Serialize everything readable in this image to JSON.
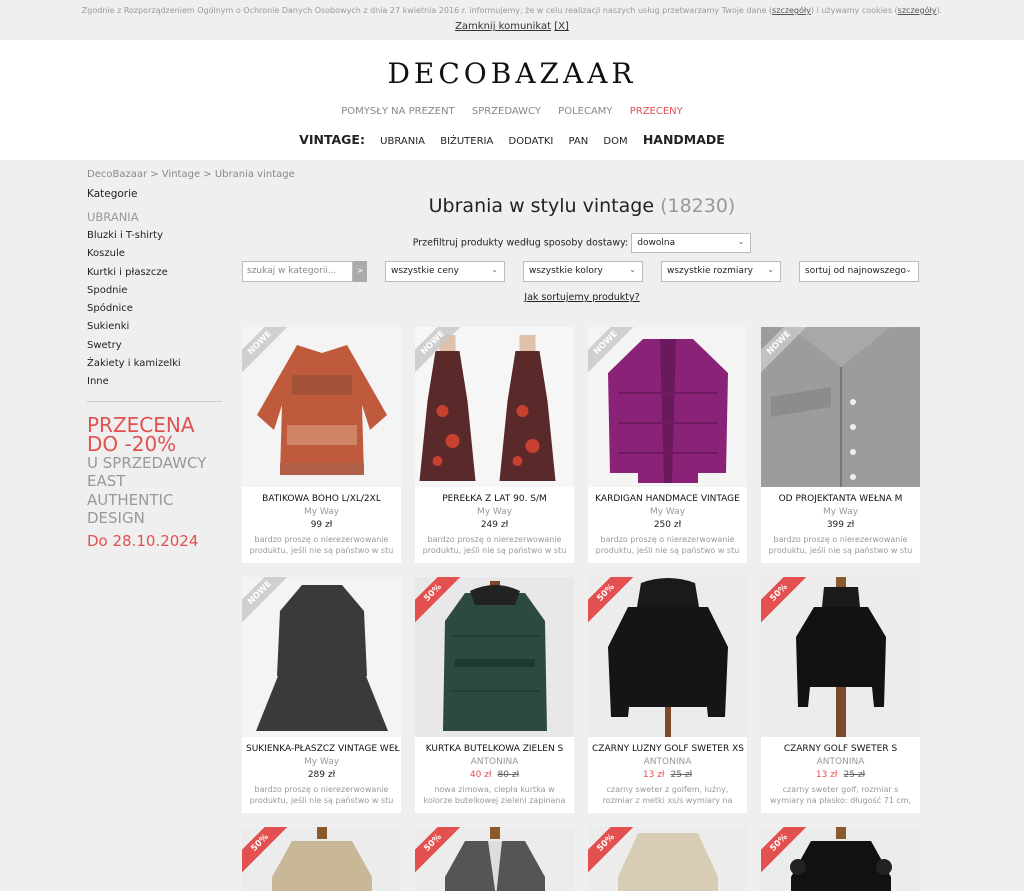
{
  "cookie": {
    "text": "Zgodnie z Rozporządzeniem Ogólnym o Ochronie Danych Osobowych z dnia 27 kwietnia 2016 r. informujemy, że w celu realizacji naszych usług przetwarzamy Twoje dane (",
    "link1": "szczegóły",
    "text2": ") i używamy cookies (",
    "link2": "szczegóły",
    "text3": ").",
    "close": "Zamknij komunikat",
    "close_x": "[X]"
  },
  "header": {
    "logo": "DECOBAZAAR",
    "topnav": [
      "POMYSŁY NA PREZENT",
      "SPRZEDAWCY",
      "POLECAMY",
      "PRZECENY"
    ],
    "vintage_label": "VINTAGE:",
    "vintage_items": [
      "UBRANIA",
      "BIŻUTERIA",
      "DODATKI",
      "PAN",
      "DOM"
    ],
    "handmade": "HANDMADE"
  },
  "breadcrumb": "DecoBazaar > Vintage > Ubrania vintage",
  "sidebar": {
    "heading": "Kategorie",
    "subheading": "UBRANIA",
    "items": [
      "Bluzki i T-shirty",
      "Koszule",
      "Kurtki i płaszcze",
      "Spodnie",
      "Spódnice",
      "Sukienki",
      "Swetry",
      "Żakiety i kamizelki",
      "Inne"
    ],
    "promo": {
      "line1": "PRZECENA",
      "line2": "DO -20%",
      "line3": "U SPRZEDAWCY",
      "line4": "EAST",
      "line5": "AUTHENTIC",
      "line6": "DESIGN",
      "date": "Do 28.10.2024"
    }
  },
  "main": {
    "title": "Ubrania w stylu vintage",
    "count": "(18230)",
    "delivery_label": "Przefiltruj produkty według sposoby dostawy:",
    "delivery_value": "dowolna",
    "search_placeholder": "szukaj w kategorii...",
    "search_btn": ">",
    "filter_price": "wszystkie ceny",
    "filter_color": "wszystkie kolory",
    "filter_size": "wszystkie rozmiary",
    "filter_sort": "sortuj od najnowszego",
    "sort_help": "Jak sortujemy produkty?"
  },
  "products": [
    {
      "name": "BATIKOWA BOHO L/XL/2XL",
      "seller": "My Way",
      "price": "99 zł",
      "old_price": "",
      "badge": "NOWE",
      "desc": "bardzo proszę o nierezerwowanie produktu, jeśli nie są państwo w stu"
    },
    {
      "name": "PEREŁKA Z LAT 90. S/M",
      "seller": "My Way",
      "price": "249 zł",
      "old_price": "",
      "badge": "NOWE",
      "desc": "bardzo proszę o nierezerwowanie produktu, jeśli nie są państwo w stu"
    },
    {
      "name": "KARDIGAN HANDMACE VINTAGE",
      "seller": "My Way",
      "price": "250 zł",
      "old_price": "",
      "badge": "NOWE",
      "desc": "bardzo proszę o nierezerwowanie produktu, jeśli nie są państwo w stu"
    },
    {
      "name": "OD PROJEKTANTA WEŁNA M",
      "seller": "My Way",
      "price": "399 zł",
      "old_price": "",
      "badge": "NOWE",
      "desc": "bardzo proszę o nierezerwowanie produktu, jeśli nie są państwo w stu"
    },
    {
      "name": "SUKIENKA-PŁASZCZ VINTAGE WEŁ",
      "seller": "My Way",
      "price": "289 zł",
      "old_price": "",
      "badge": "NOWE",
      "desc": "bardzo proszę o nierezerwowanie produktu, jeśli nie są państwo w stu"
    },
    {
      "name": "KURTKA BUTELKOWA ZIELEŃ S",
      "seller": "ANTONINA",
      "price": "40 zł",
      "old_price": "80 zł",
      "badge": "50%",
      "desc": "nowa zimowa, ciepła kurtka w kolorze butelkowej zieleni zapinana"
    },
    {
      "name": "CZARNY LUŹNY GOLF SWETER XS",
      "seller": "ANTONINA",
      "price": "13 zł",
      "old_price": "25 zł",
      "badge": "50%",
      "desc": "czarny sweter z golfem, luźny, rozmiar z metki xs/s wymiary na"
    },
    {
      "name": "CZARNY GOLF SWETER S",
      "seller": "ANTONINA",
      "price": "13 zł",
      "old_price": "25 zł",
      "badge": "50%",
      "desc": "czarny sweter golf, rozmiar s wymiary na płasko: długość 71 cm,"
    },
    {
      "name": "",
      "seller": "",
      "price": "",
      "old_price": "",
      "badge": "50%",
      "desc": ""
    },
    {
      "name": "",
      "seller": "",
      "price": "",
      "old_price": "",
      "badge": "50%",
      "desc": ""
    },
    {
      "name": "",
      "seller": "",
      "price": "",
      "old_price": "",
      "badge": "50%",
      "desc": ""
    },
    {
      "name": "",
      "seller": "",
      "price": "",
      "old_price": "",
      "badge": "50%",
      "desc": ""
    }
  ],
  "colors": {
    "accent": "#e25050",
    "muted": "#999999",
    "background": "#efefef"
  }
}
